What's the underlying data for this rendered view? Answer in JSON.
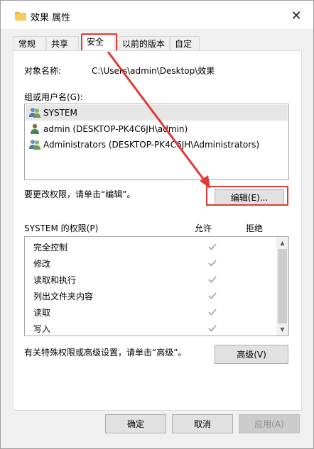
{
  "window": {
    "title": "效果 属性",
    "close_icon": "✕"
  },
  "tabs": [
    {
      "label": "常规"
    },
    {
      "label": "共享"
    },
    {
      "label": "安全"
    },
    {
      "label": "以前的版本"
    },
    {
      "label": "自定义"
    }
  ],
  "active_tab": "安全",
  "object": {
    "label": "对象名称:",
    "value": "C:\\Users\\admin\\Desktop\\效果"
  },
  "users": {
    "label": "组或用户名(G):",
    "items": [
      {
        "name": "SYSTEM",
        "icon": "user-group-icon",
        "selected": true
      },
      {
        "name": "admin (DESKTOP-PK4C6JH\\admin)",
        "icon": "user-icon",
        "selected": false
      },
      {
        "name": "Administrators (DESKTOP-PK4C6JH\\Administrators)",
        "icon": "user-group-icon",
        "selected": false
      }
    ]
  },
  "edit": {
    "hint": "要更改权限，请单击“编辑”。",
    "button": "编辑(E)..."
  },
  "permissions": {
    "label": "SYSTEM 的权限(P)",
    "allow_header": "允许",
    "deny_header": "拒绝",
    "rows": [
      {
        "name": "完全控制",
        "allow": true,
        "deny": false
      },
      {
        "name": "修改",
        "allow": true,
        "deny": false
      },
      {
        "name": "读取和执行",
        "allow": true,
        "deny": false
      },
      {
        "name": "列出文件夹内容",
        "allow": true,
        "deny": false
      },
      {
        "name": "读取",
        "allow": true,
        "deny": false
      },
      {
        "name": "写入",
        "allow": true,
        "deny": false
      }
    ]
  },
  "advanced": {
    "hint": "有关特殊权限或高级设置，请单击“高级”。",
    "button": "高级(V)"
  },
  "footer": {
    "ok": "确定",
    "cancel": "取消",
    "apply": "应用(A)"
  },
  "colors": {
    "highlight": "#e03a36",
    "checkmark": "#b0b0b0"
  }
}
